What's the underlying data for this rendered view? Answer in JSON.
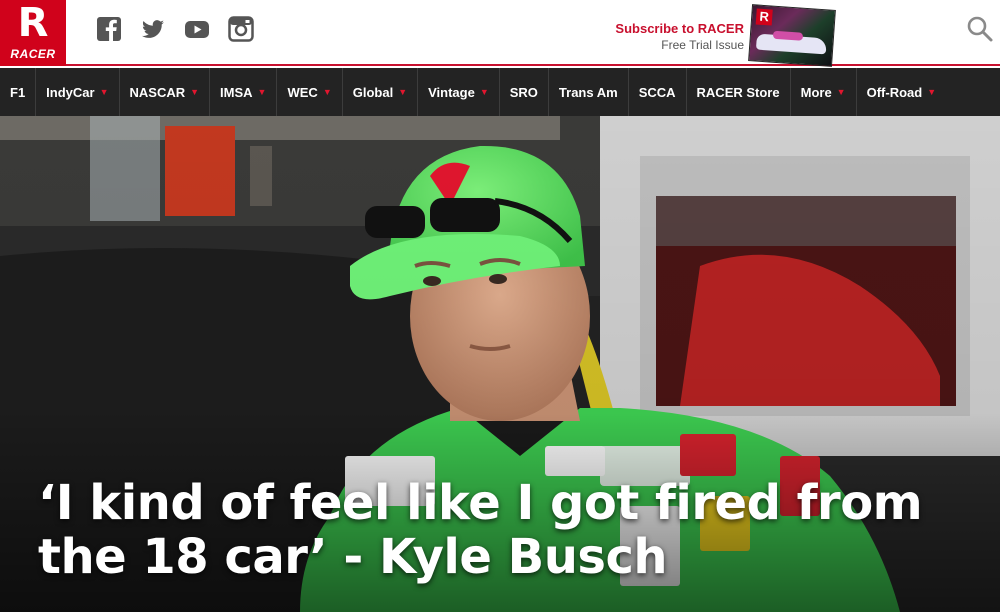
{
  "header": {
    "logo_text": "RACER",
    "logo_mark": "R",
    "social": [
      "facebook-icon",
      "twitter-icon",
      "youtube-icon",
      "instagram-icon"
    ],
    "subscribe_title": "Subscribe to RACER",
    "subscribe_sub": "Free Trial Issue",
    "magazine_mark": "R"
  },
  "nav": {
    "items": [
      {
        "label": "F1",
        "dropdown": false
      },
      {
        "label": "IndyCar",
        "dropdown": true
      },
      {
        "label": "NASCAR",
        "dropdown": true
      },
      {
        "label": "IMSA",
        "dropdown": true
      },
      {
        "label": "WEC",
        "dropdown": true
      },
      {
        "label": "Global",
        "dropdown": true
      },
      {
        "label": "Vintage",
        "dropdown": true
      },
      {
        "label": "SRO",
        "dropdown": false
      },
      {
        "label": "Trans Am",
        "dropdown": false
      },
      {
        "label": "SCCA",
        "dropdown": false
      },
      {
        "label": "RACER Store",
        "dropdown": false
      },
      {
        "label": "More",
        "dropdown": true
      },
      {
        "label": "Off-Road",
        "dropdown": true
      }
    ]
  },
  "hero": {
    "headline": "‘I kind of feel like I got fired from the 18 car’ - Kyle Busch"
  },
  "colors": {
    "brand_red": "#d0021b",
    "nav_bg": "#232323",
    "caret": "#e0162e"
  }
}
